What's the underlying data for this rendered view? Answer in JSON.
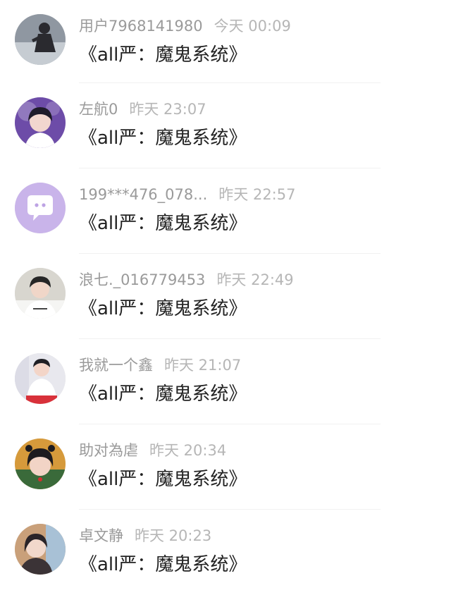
{
  "comments": [
    {
      "username": "用户7968141980",
      "time": "今天 00:09",
      "content": "《all严：魔鬼系统》",
      "avatar_icon": "user-avatar-dark-figure",
      "avatar_colors": [
        "#8f97a1",
        "#c6ccd2",
        "#2a2a2f"
      ]
    },
    {
      "username": "左航0",
      "time": "昨天 23:07",
      "content": "《all严：魔鬼系统》",
      "avatar_icon": "user-avatar-portrait",
      "avatar_colors": [
        "#6d4ca8",
        "#f2d6cf",
        "#1f1b2b"
      ]
    },
    {
      "username": "199***476_078...",
      "time": "昨天 22:57",
      "content": "《all严：魔鬼系统》",
      "avatar_icon": "default-avatar-chat-bubble",
      "avatar_colors": [
        "#c9b4ea",
        "#ffffff",
        "#bda3e4"
      ]
    },
    {
      "username": "浪七._016779453",
      "time": "昨天 22:49",
      "content": "《all严：魔鬼系统》",
      "avatar_icon": "user-avatar-portrait",
      "avatar_colors": [
        "#d8d6cf",
        "#f0d6c8",
        "#262626"
      ]
    },
    {
      "username": "我就一个鑫",
      "time": "昨天 21:07",
      "content": "《all严：魔鬼系统》",
      "avatar_icon": "user-avatar-portrait",
      "avatar_colors": [
        "#e8e8ee",
        "#f3d5c8",
        "#1f1f24"
      ]
    },
    {
      "username": "助对為虐",
      "time": "昨天 20:34",
      "content": "《all严：魔鬼系统》",
      "avatar_icon": "user-avatar-portrait",
      "avatar_colors": [
        "#d69a3b",
        "#f2d4c6",
        "#1d1b1f"
      ]
    },
    {
      "username": "卓文静",
      "time": "昨天 20:23",
      "content": "《all严：魔鬼系统》",
      "avatar_icon": "user-avatar-portrait",
      "avatar_colors": [
        "#c9a07a",
        "#f1d8cb",
        "#2a2428"
      ]
    }
  ]
}
